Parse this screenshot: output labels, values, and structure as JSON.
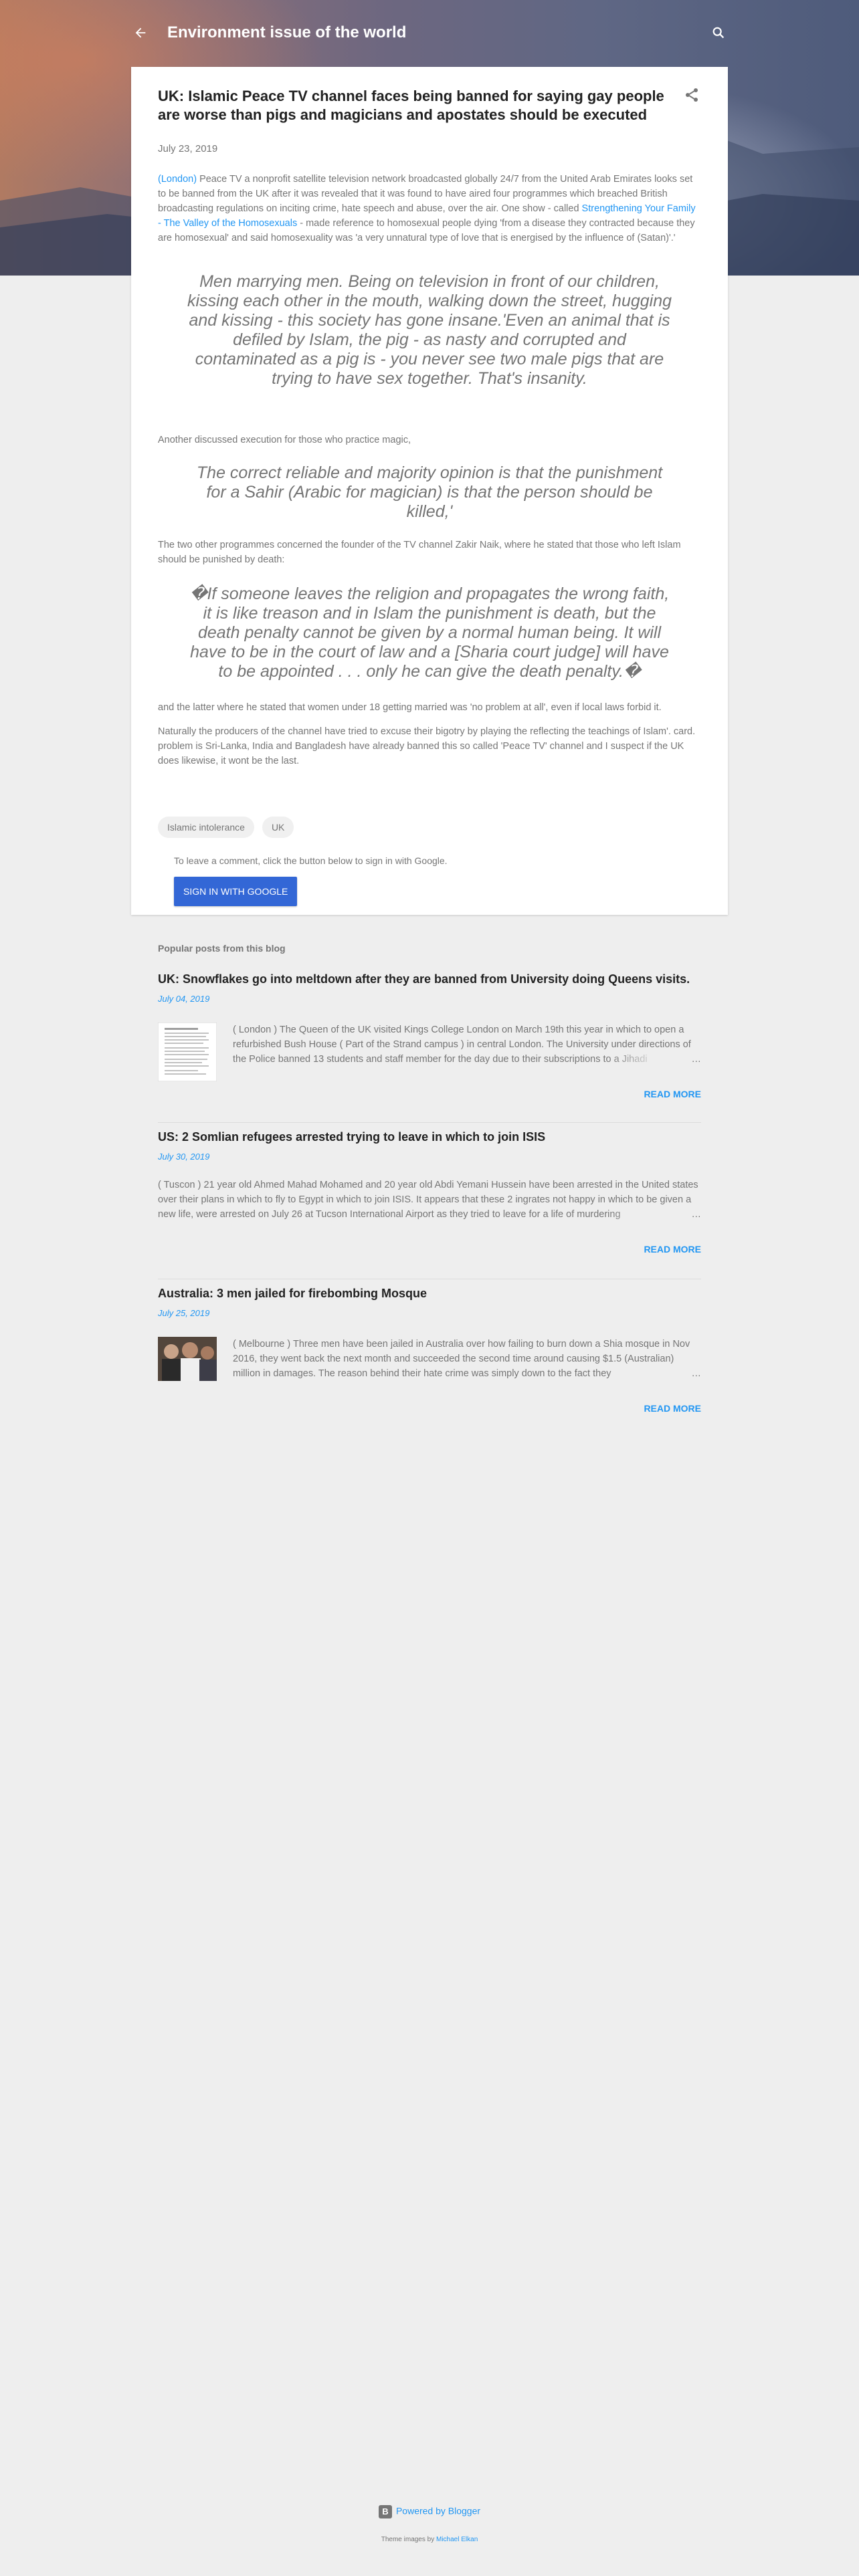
{
  "header": {
    "blog_title": "Environment issue of the world"
  },
  "post": {
    "title": "UK: Islamic Peace TV channel faces being banned for saying gay people are worse than pigs and magicians and apostates should be executed",
    "date": "July 23, 2019",
    "intro": {
      "location_link": "(London)",
      "text_part1": "  Peace TV a nonprofit satellite television network broadcasted globally 24/7 from the United Arab Emirates looks set to be banned from the UK after it was revealed that it was  found to have aired four programmes which breached British broadcasting regulations on inciting crime, hate speech and abuse, over the air. One show - called ",
      "show_link": "Strengthening Your Family - The Valley of the Homosexuals",
      "text_part2": " - made reference to homosexual people dying 'from a disease they contracted because they are homosexual' and said homosexuality was 'a very unnatural type of love that is energised by the influence of (Satan)'.'"
    },
    "quote1": "Men marrying men. Being on television in front of our children, kissing each other in the mouth, walking down the street, hugging and kissing - this society has gone insane.'Even an animal that is defiled by Islam, the pig - as nasty and corrupted and contaminated as a pig is - you never see two male pigs that are trying to have sex together. That's insanity.",
    "para1": "Another discussed execution for those who practice magic,",
    "quote2": "The correct reliable and majority opinion is that the punishment for a Sahir (Arabic for magician) is that the person should be killed,'",
    "para2": "The two other programmes concerned the founder of the TV channel Zakir Naik, where he stated that those who left Islam should be punished by death:",
    "quote3": "�If someone leaves the religion and propagates the wrong faith, it is like treason and in Islam the punishment is death, but the death penalty cannot be given by a normal human being. It will have to be in the court of law and a [Sharia court judge] will have to be appointed . . . only he can give the death penalty.�",
    "para3": "and the latter where he stated that women under 18 getting married was 'no problem at all', even if local laws forbid it.",
    "para4": "Naturally the producers of the channel have tried to excuse their bigotry by playing the reflecting the teachings of Islam'. card.  problem is Sri-Lanka, India and Bangladesh have already banned this so called 'Peace TV' channel and I suspect if the UK does likewise, it wont be the last.",
    "labels": [
      "Islamic intolerance",
      "UK"
    ],
    "comment_note": "To leave a comment, click the button below to sign in with Google.",
    "signin_label": "Sign in with Google"
  },
  "popular": {
    "heading": "Popular posts from this blog",
    "read_more": "Read more",
    "posts": [
      {
        "title": "UK: Snowflakes go into meltdown after they are banned from University doing Queens visits.",
        "date": "July 04, 2019",
        "snippet": "( London )  The Queen of the UK visited Kings College London on March 19th this year in which to open a refurbished Bush House ( Part of the Strand campus ) in central London. The University under directions of the Police banned 13 students and staff member for the day due to their subscriptions to a Jihadi",
        "thumb": "document-thumbnail"
      },
      {
        "title": "US: 2 Somlian refugees arrested trying to leave in which to join ISIS",
        "date": "July 30, 2019",
        "snippet": "( Tuscon ) 21 year old Ahmed Mahad Mohamed and 20 year old Abdi Yemani Hussein have been arrested in the United states over their plans in which to fly to Egypt in which to join ISIS.  It appears that these 2 ingrates not happy in which to be given a new life, were arrested on July 26 at Tucson International Airport as they tried to leave for a life of murdering",
        "thumb": ""
      },
      {
        "title": "Australia: 3 men jailed for firebombing Mosque",
        "date": "July 25, 2019",
        "snippet": "( Melbourne ) Three men have been jailed in Australia over how failing to burn down a Shia mosque in Nov 2016, they went back the next month and succeeded the second time around causing  $1.5 (Australian) million in damages. The reason behind their hate crime was simply down to the fact they",
        "thumb": "photo-thumbnail"
      }
    ]
  },
  "footer": {
    "powered": "Powered by Blogger",
    "credit_prefix": "Theme images by ",
    "credit_link": "Michael Elkan"
  },
  "colors": {
    "accent": "#2196f3",
    "button": "#3367d6",
    "background": "#eeeeee"
  }
}
